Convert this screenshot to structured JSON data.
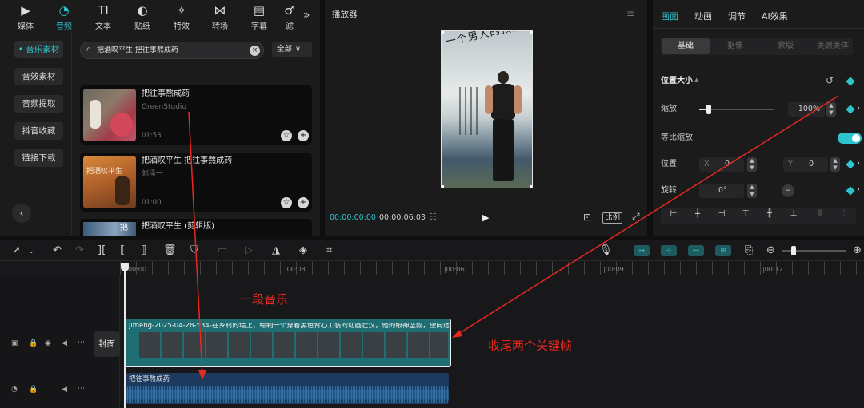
{
  "top_tabs": [
    {
      "label": "媒体",
      "icon": "media-icon",
      "active": false
    },
    {
      "label": "音频",
      "icon": "audio-icon",
      "active": true
    },
    {
      "label": "文本",
      "icon": "text-icon",
      "active": false
    },
    {
      "label": "贴纸",
      "icon": "sticker-icon",
      "active": false
    },
    {
      "label": "特效",
      "icon": "effects-icon",
      "active": false
    },
    {
      "label": "转场",
      "icon": "transition-icon",
      "active": false
    },
    {
      "label": "字幕",
      "icon": "subtitle-icon",
      "active": false
    },
    {
      "label": "滤",
      "icon": "filter-icon",
      "active": false
    }
  ],
  "audio_side_menu": [
    {
      "label": "• 音乐素材",
      "active": true
    },
    {
      "label": "音效素材",
      "active": false
    },
    {
      "label": "音频提取",
      "active": false
    },
    {
      "label": "抖音收藏",
      "active": false
    },
    {
      "label": "链接下载",
      "active": false
    }
  ],
  "search": {
    "value": "把酒叹平生 把往事熬成药",
    "filter_label": "全部"
  },
  "music_results": [
    {
      "title": "把往事熬成药",
      "artist": "GreenStudio",
      "duration": "01:53"
    },
    {
      "title": "把酒叹平生 把往事熬成药",
      "artist": "刘泽一",
      "duration": "01:00"
    },
    {
      "title": "把酒叹平生 (剪辑版)",
      "artist": "",
      "duration": ""
    }
  ],
  "thumb_cover_texts": {
    "card2": "把酒叹平生",
    "card3": "把"
  },
  "player": {
    "title": "播放器",
    "current_time": "00:00:00:00",
    "total_time": "00:00:06:03",
    "ratio_label": "比例",
    "poster_text": "一个男人的顶级修养"
  },
  "inspector": {
    "tabs": [
      {
        "label": "画面",
        "active": true
      },
      {
        "label": "动画",
        "active": false
      },
      {
        "label": "调节",
        "active": false
      },
      {
        "label": "AI效果",
        "active": false
      }
    ],
    "subtabs": [
      {
        "label": "基础",
        "active": true
      },
      {
        "label": "抠像",
        "active": false
      },
      {
        "label": "蒙版",
        "active": false
      },
      {
        "label": "美颜美体",
        "active": false
      }
    ],
    "section_title": "位置大小",
    "scale_label": "缩放",
    "scale_value": "100%",
    "scale_level": 0.1,
    "uniform_label": "等比缩放",
    "uniform_on": true,
    "position_label": "位置",
    "pos_x_label": "X",
    "pos_x": "0",
    "pos_y_label": "Y",
    "pos_y": "0",
    "rotate_label": "旋转",
    "rotate_value": "0°"
  },
  "timeline": {
    "ruler": [
      "00:00",
      "|00:03",
      "|00:06",
      "|00:09",
      "|00:12"
    ],
    "cover_label": "封面",
    "video_clip_label": "jimeng-2025-04-28-534-在乡村的墙上，绘制一个穿着黑色背心工装的动画壮汉，他的眼神坚毅，望向远",
    "audio_clip_label": "把往事熬成药"
  },
  "annotations": {
    "music": "一段音乐",
    "keyframes": "收尾两个关键帧"
  },
  "colors": {
    "accent": "#2ec4cf",
    "video_track": "#1f6e73",
    "audio_track": "#1b3a5e",
    "annotation": "#e8291e"
  }
}
